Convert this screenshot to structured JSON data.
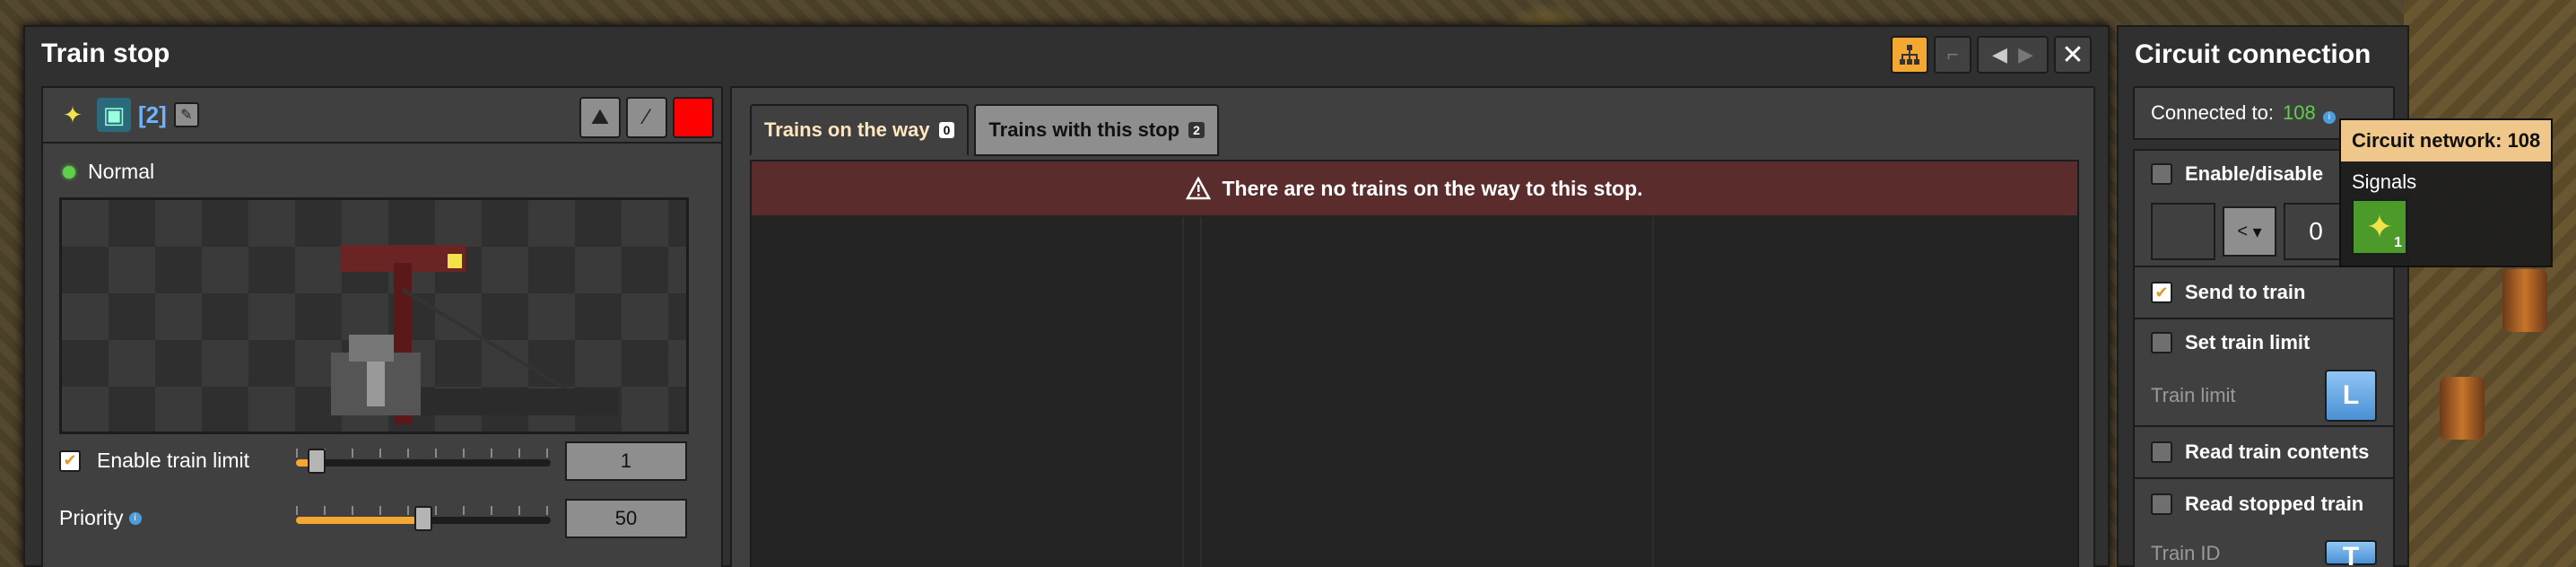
{
  "window": {
    "title": "Train stop",
    "stop_name": "[2]"
  },
  "left_panel": {
    "status": "Normal",
    "enable_train_limit_label": "Enable train limit",
    "enable_train_limit_checked": true,
    "train_limit_value": "1",
    "train_limit_slider_fraction": 0.08,
    "priority_label": "Priority",
    "priority_value": "50",
    "priority_slider_fraction": 0.5
  },
  "trains": {
    "tabs": [
      {
        "label": "Trains on the way",
        "count": "0"
      },
      {
        "label": "Trains with this stop",
        "count": "2"
      }
    ],
    "warning": "There are no trains on the way to this stop."
  },
  "circuit": {
    "title": "Circuit connection",
    "connected_label": "Connected to:",
    "connected_value": "108",
    "enable_disable_label": "Enable/disable",
    "comparator": "<",
    "constant": "0",
    "send_to_train_label": "Send to train",
    "set_train_limit_label": "Set train limit",
    "train_limit_label": "Train limit",
    "train_limit_signal": "L",
    "read_train_contents_label": "Read train contents",
    "read_stopped_train_label": "Read stopped train",
    "train_id_label": "Train ID",
    "train_id_signal": "T"
  },
  "tooltip": {
    "title": "Circuit network: 108",
    "subtitle": "Signals",
    "signal_count": "1"
  },
  "colors": {
    "accent": "#f4a731",
    "status_green": "#5fd04b",
    "warning_bg": "#5a2c2c",
    "tooltip_header": "#f0c78a",
    "station_color": "#ff0000"
  }
}
